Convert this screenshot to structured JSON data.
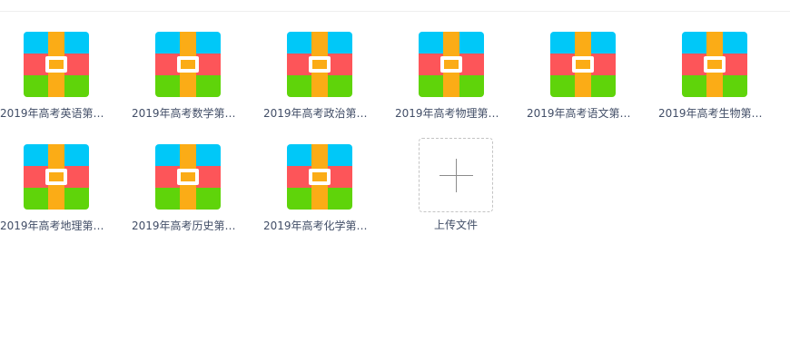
{
  "colors": {
    "band_top": "#00c8f8",
    "band_mid": "#fd5559",
    "band_bottom": "#5fd40a",
    "strap": "#fbac16"
  },
  "files": [
    {
      "name": "2019年高考英语第一...",
      "icon": "zip-archive-icon"
    },
    {
      "name": "2019年高考数学第一...",
      "icon": "zip-archive-icon"
    },
    {
      "name": "2019年高考政治第一...",
      "icon": "zip-archive-icon"
    },
    {
      "name": "2019年高考物理第一...",
      "icon": "zip-archive-icon"
    },
    {
      "name": "2019年高考语文第一...",
      "icon": "zip-archive-icon"
    },
    {
      "name": "2019年高考生物第一...",
      "icon": "zip-archive-icon"
    },
    {
      "name": "2019年高考地理第一...",
      "icon": "zip-archive-icon"
    },
    {
      "name": "2019年高考历史第一...",
      "icon": "zip-archive-icon"
    },
    {
      "name": "2019年高考化学第一...",
      "icon": "zip-archive-icon"
    }
  ],
  "upload": {
    "label": "上传文件",
    "icon": "plus-icon"
  }
}
